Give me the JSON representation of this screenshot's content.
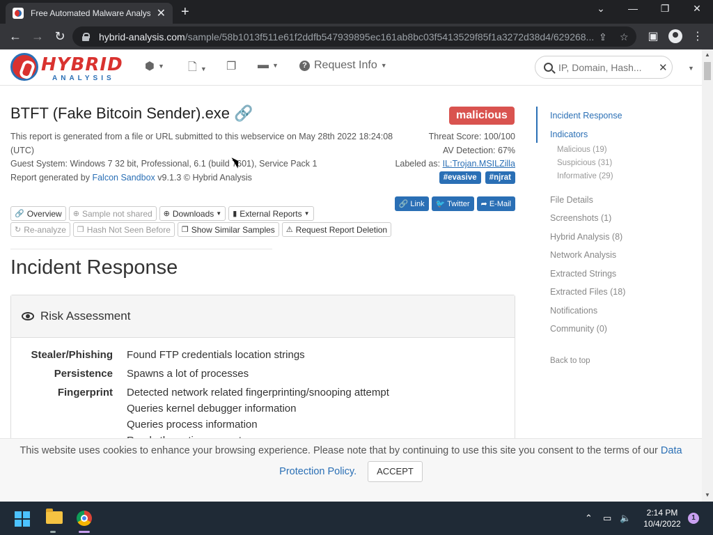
{
  "browser": {
    "tab_title": "Free Automated Malware Analysis",
    "url_host": "hybrid-analysis.com",
    "url_path": "/sample/58b1013f511e61f2ddfb547939895ec161ab8bc03f5413529f85f1a3272d38d4/629268..."
  },
  "header": {
    "logo_word": "HYBRID",
    "logo_sub": "ANALYSIS",
    "request_info": "Request Info",
    "search_placeholder": "IP, Domain, Hash..."
  },
  "report": {
    "title": "BTFT (Fake Bitcoin Sender).exe",
    "desc_line1": "This report is generated from a file or URL submitted to this webservice on May 28th 2022 18:24:08 (UTC)",
    "desc_line2": "Guest System: Windows 7 32 bit, Professional, 6.1 (build 7601), Service Pack 1",
    "desc_line3_pre": "Report generated by ",
    "desc_line3_link": "Falcon Sandbox",
    "desc_line3_post": " v9.1.3 © Hybrid Analysis",
    "verdict": "malicious",
    "threat_score": "Threat Score: 100/100",
    "av_detection": "AV Detection: 67%",
    "labeled_as_pre": "Labeled as: ",
    "labeled_as": "IL:Trojan.MSILZilla",
    "tags": [
      "#evasive",
      "#njrat"
    ],
    "share": [
      "Link",
      "Twitter",
      "E-Mail"
    ]
  },
  "buttons": {
    "overview": "Overview",
    "sample_not_shared": "Sample not shared",
    "downloads": "Downloads",
    "external_reports": "External Reports",
    "reanalyze": "Re-analyze",
    "hash_not_seen": "Hash Not Seen Before",
    "show_similar": "Show Similar Samples",
    "request_deletion": "Request Report Deletion"
  },
  "incident": {
    "section_title": "Incident Response",
    "panel_title": "Risk Assessment",
    "rows": [
      {
        "cat": "Stealer/Phishing",
        "items": [
          "Found FTP credentials location strings"
        ]
      },
      {
        "cat": "Persistence",
        "items": [
          "Spawns a lot of processes"
        ]
      },
      {
        "cat": "Fingerprint",
        "items": [
          "Detected network related fingerprinting/snooping attempt",
          "Queries kernel debugger information",
          "Queries process information",
          "Reads the active computer name"
        ]
      }
    ]
  },
  "sidebar": {
    "incident_response": "Incident Response",
    "indicators": "Indicators",
    "malicious": "Malicious (19)",
    "suspicious": "Suspicious (31)",
    "informative": "Informative (29)",
    "file_details": "File Details",
    "screenshots": "Screenshots (1)",
    "hybrid_analysis": "Hybrid Analysis (8)",
    "network_analysis": "Network Analysis",
    "extracted_strings": "Extracted Strings",
    "extracted_files": "Extracted Files (18)",
    "notifications": "Notifications",
    "community": "Community (0)",
    "back_to_top": "Back to top"
  },
  "cookie": {
    "text": "This website uses cookies to enhance your browsing experience. Please note that by continuing to use this site you consent to the terms of our ",
    "link": "Data Protection Policy.",
    "accept": "ACCEPT"
  },
  "taskbar": {
    "time": "2:14 PM",
    "date": "10/4/2022",
    "notification_count": "1"
  },
  "colors": {
    "brand_blue": "#2a6fb5",
    "malicious_red": "#d9534f"
  }
}
